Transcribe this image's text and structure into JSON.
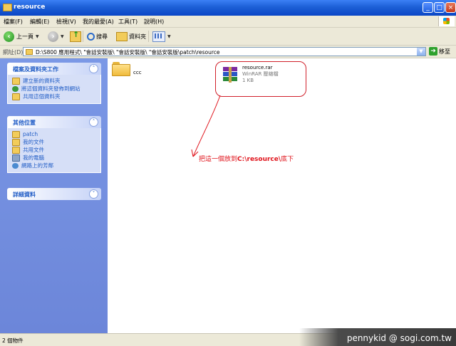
{
  "window": {
    "title": "resource"
  },
  "menu": [
    "檔案(F)",
    "編輯(E)",
    "檢視(V)",
    "我的最愛(A)",
    "工具(T)",
    "說明(H)"
  ],
  "toolbar": {
    "back_label": "上一頁",
    "search_label": "搜尋",
    "folders_label": "資料夾"
  },
  "address": {
    "label": "網址(D)",
    "path": "D:\\S800 應用程式\\ \"會話安裝版\\ \"會話安裝版\\ \"會話安裝版\\patch\\resource",
    "go_label": "移至"
  },
  "tasks_panel": {
    "title": "檔案及資料夾工作",
    "items": [
      "建立新的資料夾",
      "將這個資料夾發佈到網站",
      "共用這個資料夾"
    ]
  },
  "places_panel": {
    "title": "其他位置",
    "items": [
      "patch",
      "我的文件",
      "共用文件",
      "我的電腦",
      "網路上的芳鄰"
    ]
  },
  "details_panel": {
    "title": "詳細資料"
  },
  "content": {
    "folder_name": "ccc",
    "file_name": "resource.rar",
    "file_type": "WinRAR 壓縮檔",
    "file_size": "1 KB",
    "note_prefix": "把這一個放到",
    "note_path": "C:\\resource\\",
    "note_suffix": "底下"
  },
  "status": {
    "text": "2 個物件"
  },
  "watermark": {
    "text": "pennykid @ sogi.com.tw"
  },
  "colors": {
    "title_bar": "#1d5fd6",
    "task_pane": "#7b98e6",
    "link": "#215dc6",
    "annotation": "#e0141c"
  },
  "icons": [
    "folder-icon",
    "back-icon",
    "forward-icon",
    "up-folder-icon",
    "search-icon",
    "views-icon",
    "go-icon",
    "rar-icon"
  ]
}
